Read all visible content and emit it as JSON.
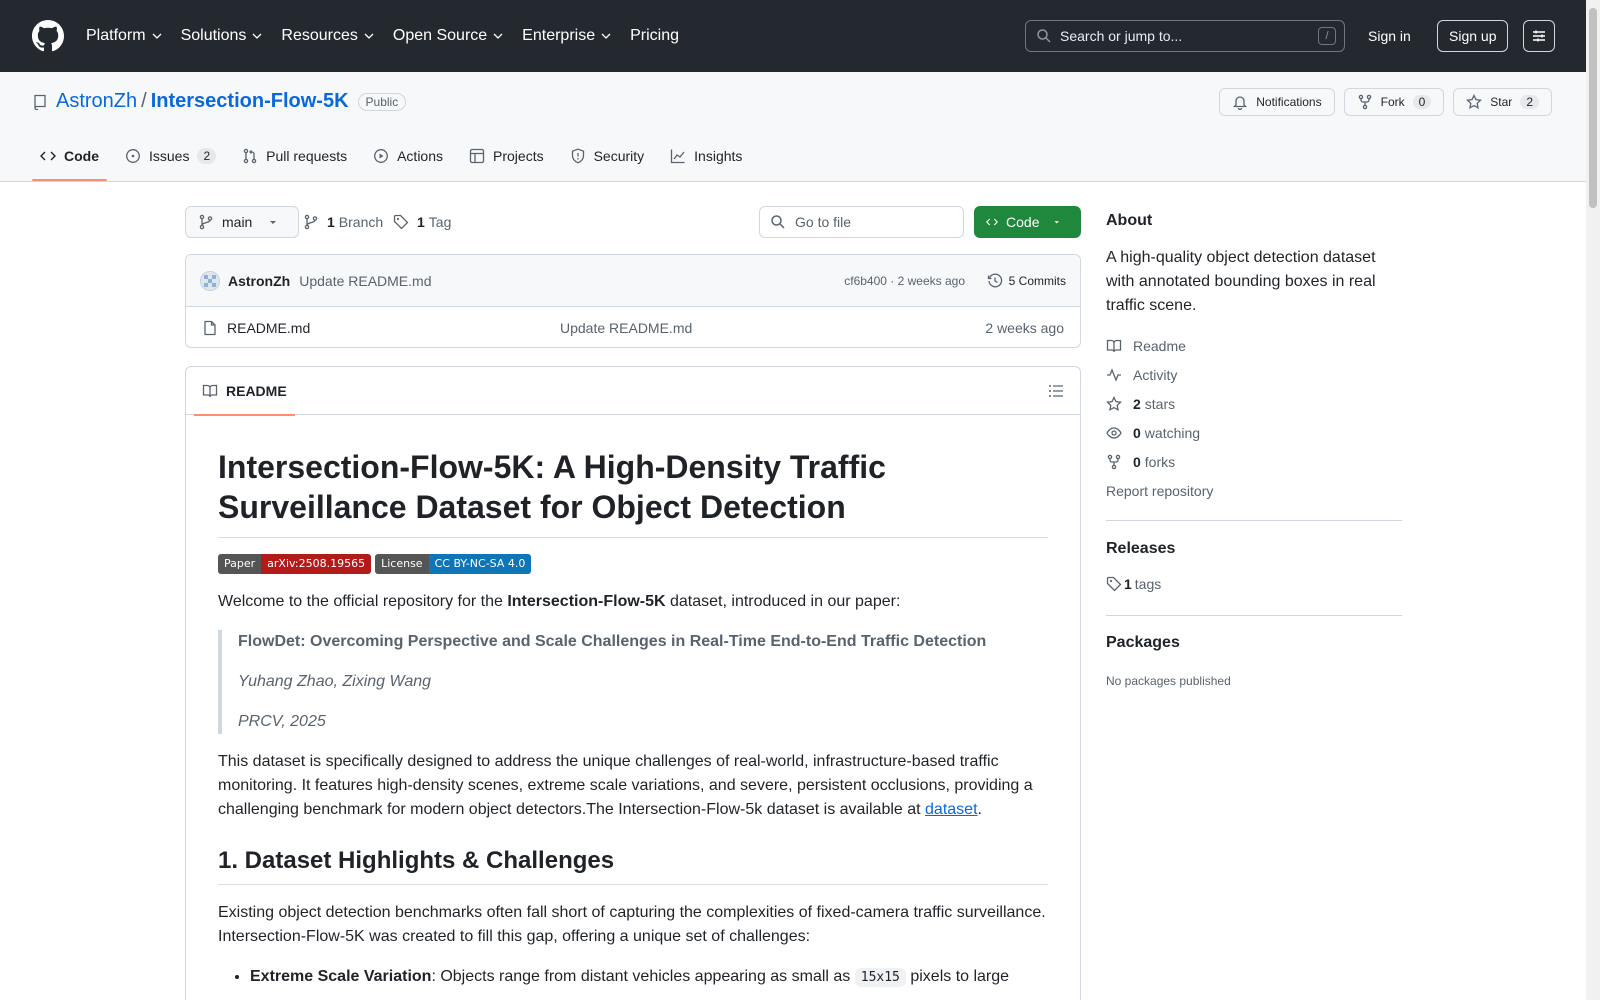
{
  "header": {
    "nav": [
      "Platform",
      "Solutions",
      "Resources",
      "Open Source",
      "Enterprise",
      "Pricing"
    ],
    "search_placeholder": "Search or jump to...",
    "search_shortcut": "/",
    "signin": "Sign in",
    "signup": "Sign up"
  },
  "repo": {
    "owner": "AstronZh",
    "separator": "/",
    "name": "Intersection-Flow-5K",
    "visibility": "Public",
    "notifications_label": "Notifications",
    "fork_label": "Fork",
    "fork_count": "0",
    "star_label": "Star",
    "star_count": "2"
  },
  "tabs": [
    {
      "label": "Code",
      "count": ""
    },
    {
      "label": "Issues",
      "count": "2"
    },
    {
      "label": "Pull requests",
      "count": ""
    },
    {
      "label": "Actions",
      "count": ""
    },
    {
      "label": "Projects",
      "count": ""
    },
    {
      "label": "Security",
      "count": ""
    },
    {
      "label": "Insights",
      "count": ""
    }
  ],
  "filenav": {
    "branch": "main",
    "branch_count": "1",
    "branch_label": "Branch",
    "tag_count": "1",
    "tag_label": "Tag",
    "goto_placeholder": "Go to file",
    "code_label": "Code"
  },
  "commit": {
    "author": "AstronZh",
    "message": "Update README.md",
    "meta": "cf6b400 · 2 weeks ago",
    "commits_count": "5 Commits"
  },
  "files": [
    {
      "name": "README.md",
      "message": "Update README.md",
      "age": "2 weeks ago"
    }
  ],
  "readme": {
    "tab_label": "README",
    "title": "Intersection-Flow-5K: A High-Density Traffic Surveillance Dataset for Object Detection",
    "badges": [
      {
        "left": "Paper",
        "right": "arXiv:2508.19565",
        "color": "#b31b1b"
      },
      {
        "left": "License",
        "right": "CC BY-NC-SA 4.0",
        "color": "#0e75b6"
      }
    ],
    "intro_pre": "Welcome to the official repository for the ",
    "intro_bold": "Intersection-Flow-5K",
    "intro_post": " dataset, introduced in our paper:",
    "quote_title": "FlowDet: Overcoming Perspective and Scale Challenges in Real-Time End-to-End Traffic Detection",
    "quote_authors": "Yuhang Zhao, Zixing Wang",
    "quote_venue": "PRCV, 2025",
    "para2": "This dataset is specifically designed to address the unique challenges of real-world, infrastructure-based traffic monitoring. It features high-density scenes, extreme scale variations, and severe, persistent occlusions, providing a challenging benchmark for modern object detectors.The Intersection-Flow-5k dataset is available at ",
    "para2_link": "dataset",
    "para2_end": ".",
    "h2": "1. Dataset Highlights & Challenges",
    "para3": "Existing object detection benchmarks often fall short of capturing the complexities of fixed-camera traffic surveillance. Intersection-Flow-5K was created to fill this gap, offering a unique set of challenges:",
    "bullet1_bold": "Extreme Scale Variation",
    "bullet1_text": ": Objects range from distant vehicles appearing as small as ",
    "bullet1_code": "15x15",
    "bullet1_end": " pixels to large"
  },
  "about": {
    "heading": "About",
    "description": "A high-quality object detection dataset with annotated bounding boxes in real traffic scene.",
    "readme": "Readme",
    "activity": "Activity",
    "stars_count": "2",
    "stars_label": "stars",
    "watching_count": "0",
    "watching_label": "watching",
    "forks_count": "0",
    "forks_label": "forks",
    "report": "Report repository"
  },
  "releases": {
    "heading": "Releases",
    "tags_count": "1",
    "tags_label": "tags"
  },
  "packages": {
    "heading": "Packages",
    "note": "No packages published"
  }
}
